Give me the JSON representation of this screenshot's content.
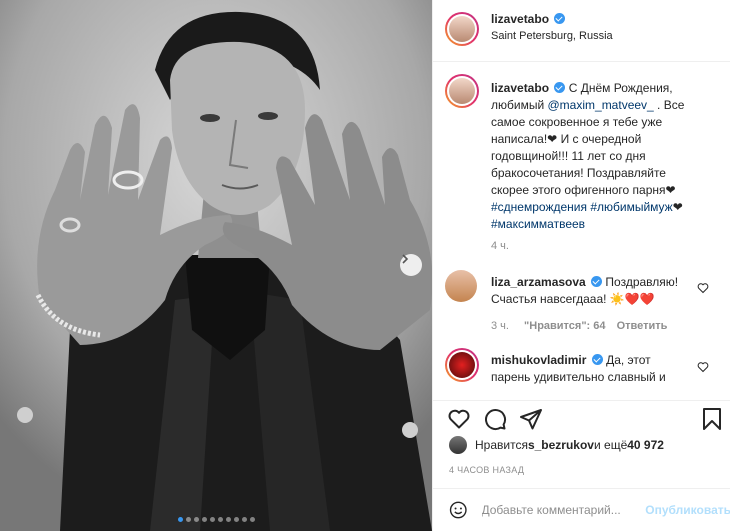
{
  "post": {
    "username": "lizavetabo",
    "location": "Saint Petersburg, Russia"
  },
  "caption": {
    "username": "lizavetabo",
    "line1": "С Днём Рождения,",
    "line2_pre": "любимый ",
    "mention": "@maxim_matveev_",
    "line2_post": " . Все",
    "line3": "самое сокровенное я тебе уже",
    "line4": "написала!❤ И с очередной",
    "line5": "годовщиной!!! 11 лет со дня",
    "line6": "бракосочетания! Поздравляйте",
    "line7": "скорее этого офигенного парня❤",
    "hashtag1": "#сднемрождения",
    "hashtag2": "#любимыймуж",
    "hashtag3": "#максимматвеев",
    "heart_after_tags": "❤",
    "time": "4 ч."
  },
  "comments": [
    {
      "username": "liza_arzamasova",
      "line1": "Поздравляю!",
      "line2": "Счастья навсегдааа! ☀️❤️❤️",
      "time": "3 ч.",
      "likes": "\"Нравится\": 64",
      "reply": "Ответить"
    },
    {
      "username": "mishukovladimir",
      "line1": "Да, этот",
      "line2": "парень удивительно славный и"
    }
  ],
  "likes": {
    "prefix": "Нравится ",
    "user": "s_bezrukov",
    "middle": " и ещё ",
    "count": "40 972"
  },
  "posted_time": "4 ЧАСОВ НАЗАД",
  "comment_box": {
    "placeholder": "Добавьте комментарий...",
    "publish": "Опубликовать"
  },
  "colors": {
    "accent": "#3897f0",
    "link": "#00376b",
    "muted": "#8e8e8e",
    "publish_disabled": "#b2dffc"
  },
  "icons": [
    "heart-icon",
    "comment-icon",
    "share-icon",
    "bookmark-icon",
    "emoji-icon",
    "verified-icon",
    "chevron-right-icon"
  ],
  "carousel": {
    "total": 10,
    "active": 1
  }
}
